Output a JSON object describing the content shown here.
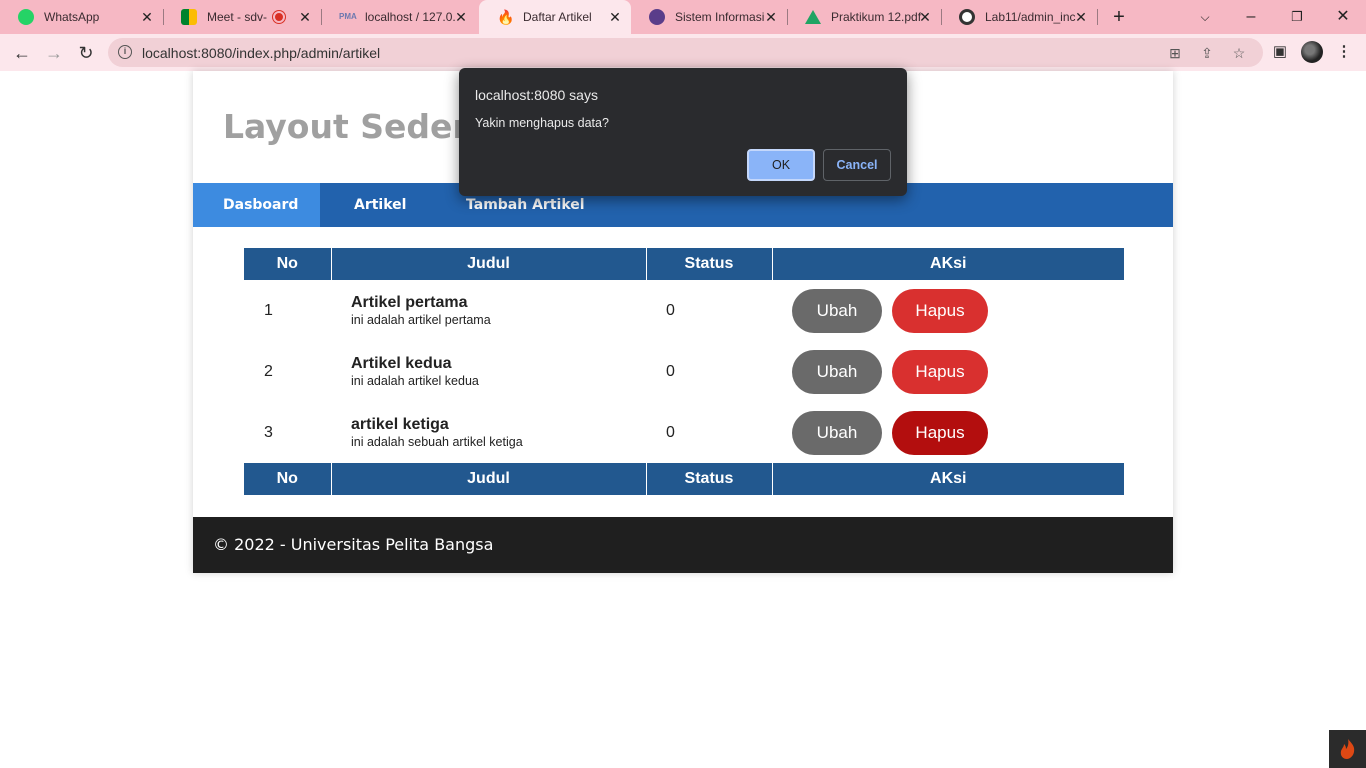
{
  "browser": {
    "tabs": [
      {
        "label": "WhatsApp",
        "icon": "whatsapp-icon"
      },
      {
        "label": "Meet - sdv-a",
        "icon": "google-meet-icon"
      },
      {
        "label": "localhost / 127.0.",
        "icon": "phpmyadmin-icon"
      },
      {
        "label": "Daftar Artikel",
        "icon": "codeigniter-icon"
      },
      {
        "label": "Sistem Informasi",
        "icon": "university-icon"
      },
      {
        "label": "Praktikum 12.pdf",
        "icon": "google-drive-icon"
      },
      {
        "label": "Lab11/admin_inc",
        "icon": "github-icon"
      }
    ],
    "active_tab_index": 3,
    "url": "localhost:8080/index.php/admin/artikel"
  },
  "header": {
    "title": "Layout Sederhana"
  },
  "nav": {
    "items": [
      {
        "label": "Dasboard"
      },
      {
        "label": "Artikel"
      },
      {
        "label": "Tambah Artikel"
      }
    ],
    "active_index": 0
  },
  "table": {
    "columns": [
      "No",
      "Judul",
      "Status",
      "AKsi"
    ],
    "rows": [
      {
        "no": "1",
        "judul": "Artikel pertama",
        "deskripsi": "ini adalah artikel pertama",
        "status": "0",
        "ubah": "Ubah",
        "hapus": "Hapus"
      },
      {
        "no": "2",
        "judul": "Artikel kedua",
        "deskripsi": "ini adalah artikel kedua",
        "status": "0",
        "ubah": "Ubah",
        "hapus": "Hapus"
      },
      {
        "no": "3",
        "judul": "artikel ketiga",
        "deskripsi": "ini adalah sebuah artikel ketiga",
        "status": "0",
        "ubah": "Ubah",
        "hapus": "Hapus"
      }
    ]
  },
  "footer": {
    "text": "© 2022 - Universitas Pelita Bangsa"
  },
  "dialog": {
    "origin": "localhost:8080 says",
    "message": "Yakin menghapus data?",
    "ok_label": "OK",
    "cancel_label": "Cancel"
  },
  "colors": {
    "tabstrip": "#f6b8c4",
    "nav": "#2262ad",
    "nav_active": "#3d8be0",
    "table_header": "#22588f",
    "btn_ubah": "#6a6a6a",
    "btn_hapus": "#d9302f",
    "footer": "#1f1f1f",
    "dialog_ok": "#8ab4f8"
  }
}
